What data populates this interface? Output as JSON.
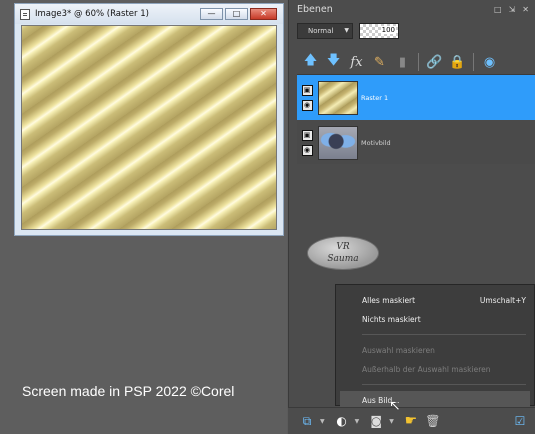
{
  "image_window": {
    "title": "Image3* @  60% (Raster 1)",
    "buttons": [
      "—",
      "□",
      "✕"
    ]
  },
  "credit": "Screen made in PSP 2022 ©Corel",
  "layers_panel": {
    "title": "Ebenen",
    "header_buttons": [
      "□",
      "⇲",
      "✕"
    ],
    "blend_mode": "Normal",
    "opacity": "100",
    "layers": [
      {
        "name": "Raster 1",
        "selected": true
      },
      {
        "name": "Motivbild",
        "selected": false
      }
    ]
  },
  "watermark": {
    "line1": "VR",
    "line2": "Sauma"
  },
  "context_menu": {
    "items": [
      {
        "label": "Alles maskiert",
        "shortcut": "Umschalt+Y",
        "enabled": true
      },
      {
        "label": "Nichts maskiert",
        "shortcut": "",
        "enabled": true
      },
      {
        "label": "Auswahl maskieren",
        "shortcut": "",
        "enabled": false
      },
      {
        "label": "Außerhalb der Auswahl maskieren",
        "shortcut": "",
        "enabled": false
      },
      {
        "label": "Aus Bild...",
        "shortcut": "",
        "enabled": true,
        "highlighted": true
      }
    ]
  },
  "colors": {
    "selection": "#2f9cfa",
    "panel": "#4c4c4c",
    "workspace": "#5e5e5e"
  }
}
